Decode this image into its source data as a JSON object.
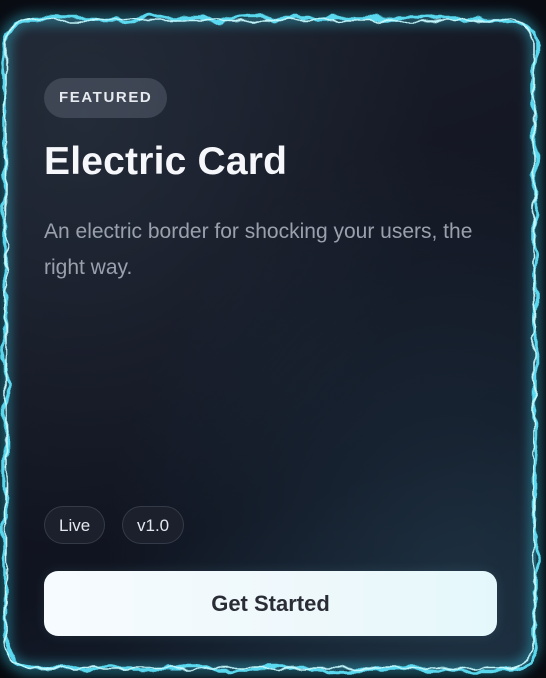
{
  "card": {
    "badge": "FEATURED",
    "title": "Electric Card",
    "description": "An electric border for shocking your users, the right way.",
    "tags": [
      "Live",
      "v1.0"
    ],
    "cta_label": "Get Started"
  },
  "colors": {
    "border_glow": "#5fe8ff",
    "border_core": "#c8fbff",
    "card_background": "#131622",
    "button_background": "#eef8fb"
  }
}
